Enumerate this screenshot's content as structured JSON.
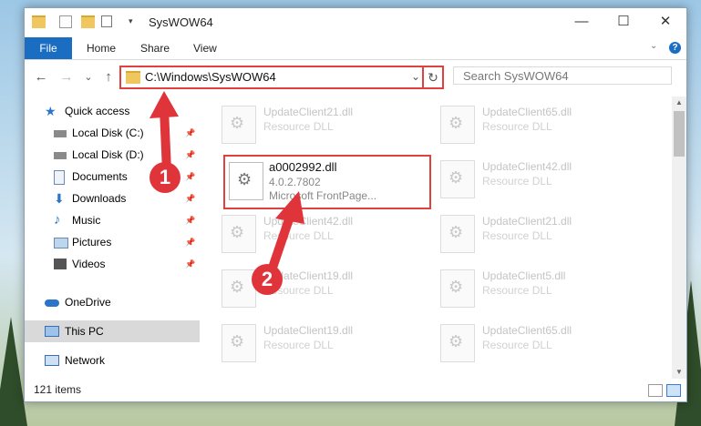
{
  "window": {
    "title": "SysWOW64"
  },
  "ribbon": {
    "tabs": [
      "File",
      "Home",
      "Share",
      "View"
    ],
    "help": "?"
  },
  "nav": {
    "address": "C:\\Windows\\SysWOW64",
    "search_placeholder": "Search SysWOW64",
    "back": "←",
    "forward": "→",
    "recent": "⌄",
    "up": "↑",
    "refresh": "↻"
  },
  "sidebar": {
    "items": [
      {
        "label": "Quick access",
        "icon": "star-icon"
      },
      {
        "label": "Local Disk (C:)",
        "icon": "drive-icon"
      },
      {
        "label": "Local Disk (D:)",
        "icon": "drive-icon"
      },
      {
        "label": "Documents",
        "icon": "document-icon"
      },
      {
        "label": "Downloads",
        "icon": "download-icon"
      },
      {
        "label": "Music",
        "icon": "music-icon"
      },
      {
        "label": "Pictures",
        "icon": "picture-icon"
      },
      {
        "label": "Videos",
        "icon": "video-icon"
      },
      {
        "label": "OneDrive",
        "icon": "cloud-icon"
      },
      {
        "label": "This PC",
        "icon": "computer-icon"
      },
      {
        "label": "Network",
        "icon": "network-icon"
      }
    ]
  },
  "files": {
    "highlighted": {
      "name": "a0002992.dll",
      "version": "4.0.2.7802",
      "company": "Microsoft FrontPage..."
    },
    "left_column": [
      {
        "name": "UpdateClient21.dll",
        "desc": "Resource DLL"
      },
      {
        "name": "UpdateClient42.dll",
        "desc": "Resource DLL"
      },
      {
        "name": "UpdateClient19.dll",
        "desc": "Resource DLL"
      },
      {
        "name": "UpdateClient19.dll",
        "desc": "Resource DLL"
      }
    ],
    "right_column": [
      {
        "name": "UpdateClient65.dll",
        "desc": "Resource DLL"
      },
      {
        "name": "UpdateClient42.dll",
        "desc": "Resource DLL"
      },
      {
        "name": "UpdateClient21.dll",
        "desc": "Resource DLL"
      },
      {
        "name": "UpdateClient5.dll",
        "desc": "Resource DLL"
      },
      {
        "name": "UpdateClient65.dll",
        "desc": "Resource DLL"
      }
    ]
  },
  "status": {
    "count": "121 items"
  },
  "annotations": {
    "badge1": "1",
    "badge2": "2"
  },
  "colors": {
    "accent": "#1a6dc1",
    "highlight": "#e23f3f",
    "badge": "#e0343b"
  }
}
